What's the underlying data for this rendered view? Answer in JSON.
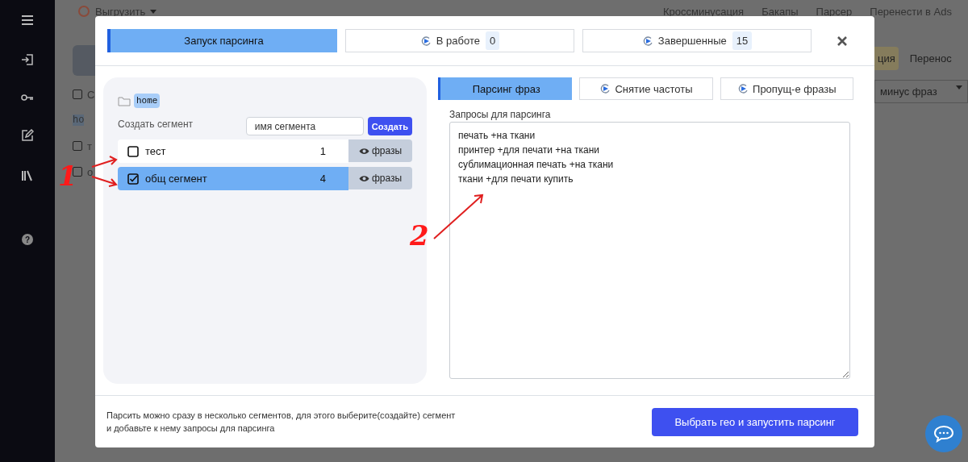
{
  "background": {
    "top_menu": {
      "export_label": "Выгрузить",
      "items": [
        "Кроссминусация",
        "Бакапы",
        "Парсер",
        "Перенести в Ads"
      ]
    },
    "side_rows": [
      {
        "text": "С",
        "checked": false
      },
      {
        "text": "т",
        "checked": false
      },
      {
        "text": "о",
        "checked": false
      }
    ],
    "help_glyph": "?",
    "folder_label": "ho",
    "right_buttons": [
      "ция",
      "Перенос"
    ],
    "right_select": "минус фраз"
  },
  "modal": {
    "tabs": [
      {
        "label": "Запуск парсинга",
        "selected": true
      },
      {
        "label": "В работе",
        "count": "0",
        "selected": false
      },
      {
        "label": "Завершенные",
        "count": "15",
        "selected": false
      }
    ],
    "folder": "home",
    "create_label": "Создать сегмент",
    "segment_input": {
      "placeholder": "имя сегмента"
    },
    "create_button": "Создать",
    "segments": [
      {
        "name": "тест",
        "count": "1",
        "checked": false,
        "selected": false,
        "action": "фразы"
      },
      {
        "name": "общ сегмент",
        "count": "4",
        "checked": true,
        "selected": true,
        "action": "фразы"
      }
    ],
    "subtabs": [
      {
        "label": "Парсинг фраз",
        "selected": true
      },
      {
        "label": "Снятие частоты",
        "selected": false
      },
      {
        "label": "Пропущ-е фразы",
        "selected": false
      }
    ],
    "queries_label": "Запросы для парсинга",
    "queries": "печать +на ткани\nпринтер +для печати +на ткани\nсублимационная печать +на ткани\nткани +для печати купить",
    "footer_text": [
      "Парсить можно сразу в несколько сегментов, для этого выберите(создайте) сегмент",
      "и добавьте к нему запросы для парсинга"
    ],
    "submit_button": "Выбрать гео и запустить парсинг"
  },
  "annotations": [
    {
      "label": "1"
    },
    {
      "label": "2"
    }
  ]
}
